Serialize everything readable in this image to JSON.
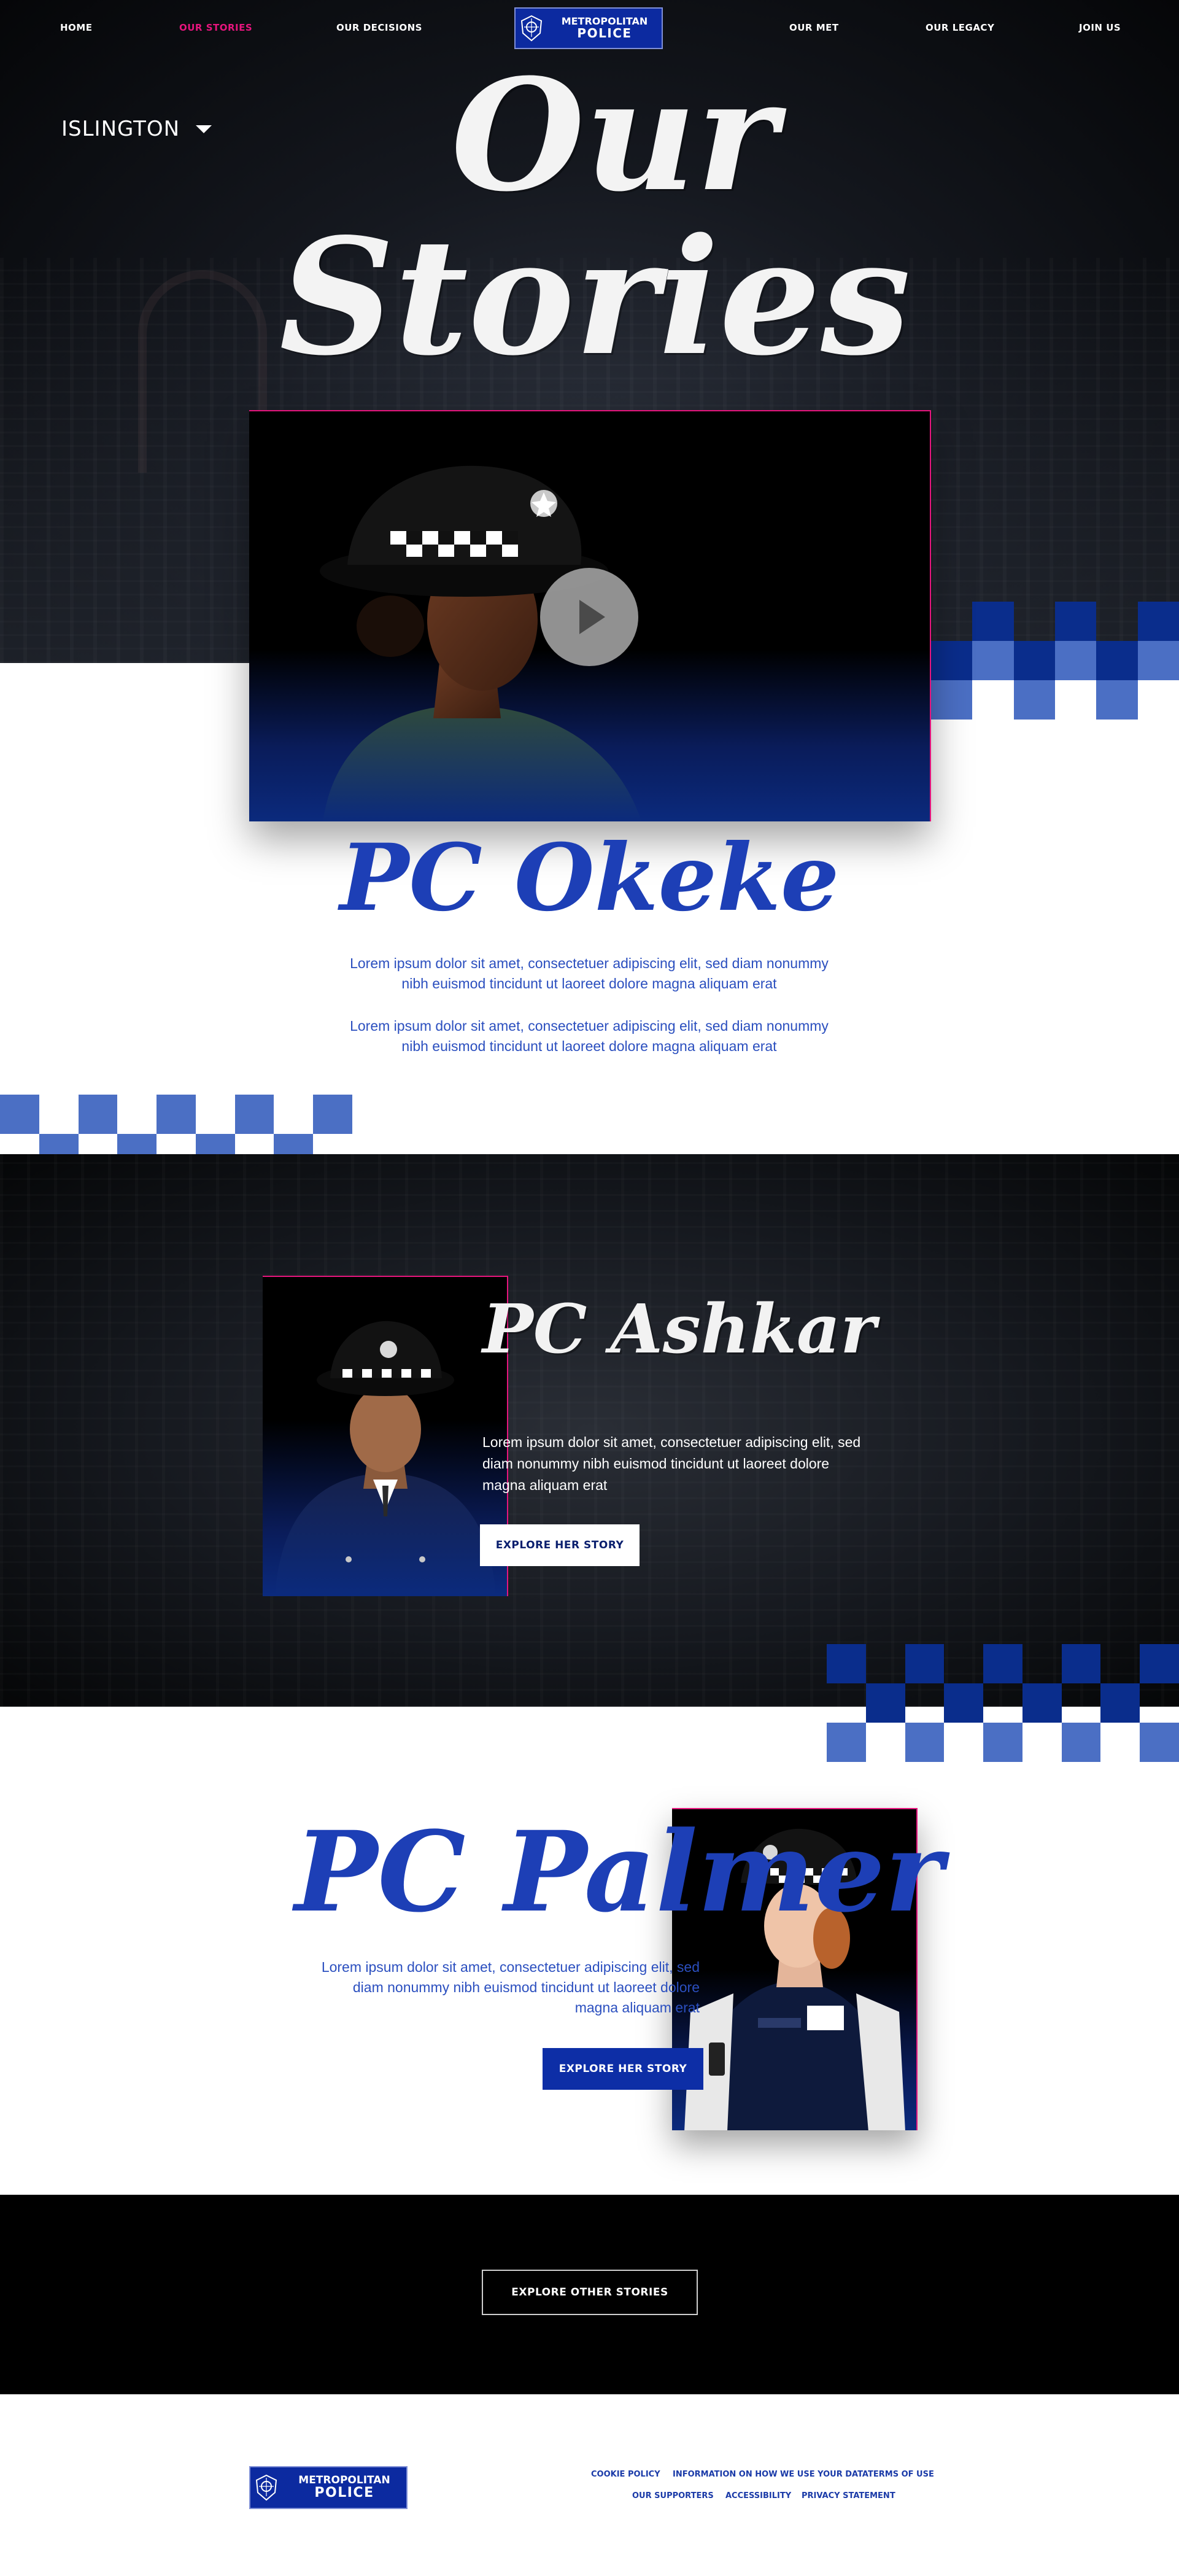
{
  "nav": {
    "home": "HOME",
    "our_stories": "OUR STORIES",
    "our_decisions": "OUR DECISIONS",
    "our_met": "OUR MET",
    "our_legacy": "OUR LEGACY",
    "join_us": "JOIN US",
    "logo_line1": "METROPOLITAN",
    "logo_line2": "POLICE"
  },
  "hero": {
    "borough": "ISLINGTON",
    "title_line1": "Our",
    "title_line2": "Stories"
  },
  "okeke": {
    "name": "PC Okeke",
    "paragraph1": "Lorem ipsum dolor sit amet, consectetuer adipiscing elit, sed diam nonummy nibh euismod tincidunt ut laoreet dolore magna aliquam erat",
    "paragraph2": "Lorem ipsum dolor sit amet, consectetuer adipiscing elit, sed diam nonummy nibh euismod tincidunt ut laoreet dolore magna aliquam erat"
  },
  "ashkar": {
    "name": "PC Ashkar",
    "paragraph": "Lorem ipsum dolor sit amet, consectetuer adipiscing elit, sed diam nonummy nibh euismod tincidunt ut laoreet dolore magna aliquam erat",
    "button": "EXPLORE HER STORY"
  },
  "palmer": {
    "name": "PC Palmer",
    "paragraph": "Lorem ipsum dolor sit amet, consectetuer adipiscing elit, sed diam nonummy nibh euismod tincidunt ut laoreet dolore magna aliquam erat",
    "button": "EXPLORE HER STORY"
  },
  "explore": {
    "button": "EXPLORE OTHER STORIES"
  },
  "footer": {
    "logo_line1": "METROPOLITAN",
    "logo_line2": "POLICE",
    "links_row1": [
      "COOKIE POLICY",
      "INFORMATION ON HOW WE USE YOUR DATA",
      "TERMS OF USE"
    ],
    "links_row2": [
      "OUR SUPPORTERS",
      "ACCESSIBILITY",
      "PRIVACY STATEMENT"
    ]
  },
  "colors": {
    "accent_pink": "#e6157d",
    "met_blue": "#0d2ea6",
    "checker_dark": "#0a2d8c",
    "checker_light": "#4b6fc4"
  }
}
